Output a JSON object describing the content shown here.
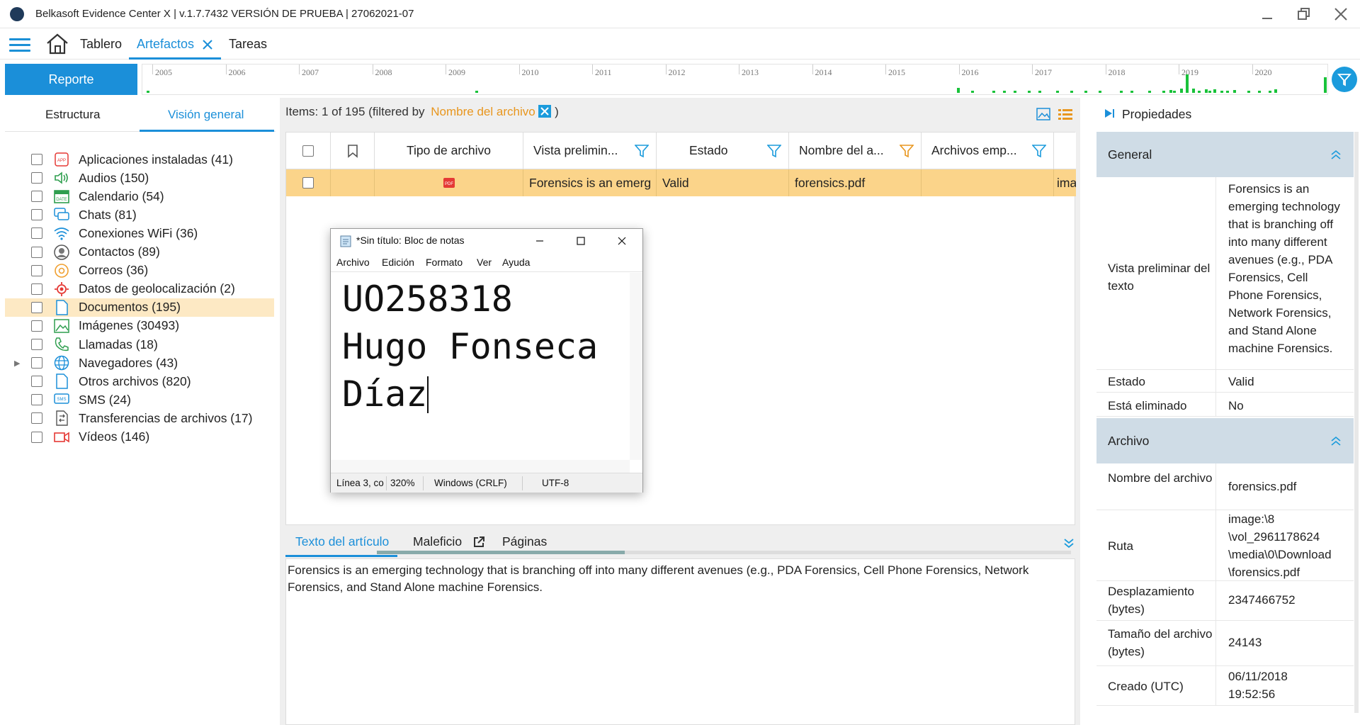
{
  "window": {
    "title": "Belkasoft Evidence Center X | v.1.7.7432 VERSIÓN DE PRUEBA | 27062021-07"
  },
  "nav": {
    "home": "Tablero",
    "tab_active": "Artefactos",
    "tab_tasks": "Tareas"
  },
  "toolbar": {
    "report_label": "Reporte"
  },
  "timeline": {
    "years": [
      "2005",
      "2006",
      "2007",
      "2008",
      "2009",
      "2010",
      "2011",
      "2012",
      "2013",
      "2014",
      "2015",
      "2016",
      "2017",
      "2018",
      "2019",
      "2020"
    ]
  },
  "left": {
    "tabs": [
      "Estructura",
      "Visión general"
    ],
    "items": [
      {
        "label": "Aplicaciones instaladas (41)",
        "icon": "app-icon"
      },
      {
        "label": "Audios (150)",
        "icon": "audio-icon"
      },
      {
        "label": "Calendario (54)",
        "icon": "calendar-icon"
      },
      {
        "label": "Chats (81)",
        "icon": "chat-icon"
      },
      {
        "label": "Conexiones WiFi (36)",
        "icon": "wifi-icon"
      },
      {
        "label": "Contactos (89)",
        "icon": "contact-icon"
      },
      {
        "label": "Correos (36)",
        "icon": "mail-icon"
      },
      {
        "label": "Datos de geolocalización (2)",
        "icon": "location-icon"
      },
      {
        "label": "Documentos (195)",
        "icon": "document-icon"
      },
      {
        "label": "Imágenes (30493)",
        "icon": "image-icon"
      },
      {
        "label": "Llamadas (18)",
        "icon": "phone-icon"
      },
      {
        "label": "Navegadores (43)",
        "icon": "globe-icon"
      },
      {
        "label": "Otros archivos (820)",
        "icon": "file-icon"
      },
      {
        "label": "SMS (24)",
        "icon": "sms-icon"
      },
      {
        "label": "Transferencias de archivos (17)",
        "icon": "transfer-icon"
      },
      {
        "label": "Vídeos (146)",
        "icon": "video-icon"
      }
    ]
  },
  "middle": {
    "items_prefix": "Items: 1 of 195 (filtered by",
    "filter_name": "Nombre del archivo",
    "items_suffix": ")",
    "columns": [
      "Tipo de archivo",
      "Vista prelimin...",
      "Estado",
      "Nombre del a...",
      "Archivos emp..."
    ],
    "row": {
      "preview": "Forensics is an emerg",
      "status": "Valid",
      "filename": "forensics.pdf",
      "extra": "ima"
    },
    "bottom_tabs": [
      "Texto del artículo",
      "Maleficio",
      "Páginas"
    ],
    "article_text": "Forensics is an emerging technology that is branching off into many different avenues (e.g., PDA Forensics, Cell Phone Forensics, Network Forensics, and Stand Alone machine Forensics."
  },
  "notepad": {
    "title": "*Sin título: Bloc de notas",
    "menu": [
      "Archivo",
      "Edición",
      "Formato",
      "Ver",
      "Ayuda"
    ],
    "lines": [
      "UO258318",
      "Hugo Fonseca",
      "Díaz"
    ],
    "status": {
      "pos": "Línea 3, co",
      "zoom": "320%",
      "eol": "Windows (CRLF)",
      "enc": "UTF-8"
    }
  },
  "props": {
    "title": "Propiedades",
    "general_header": "General",
    "preview_key": "Vista preliminar del texto",
    "preview_val": "Forensics is an emerging technology that is branching off into many different avenues (e.g., PDA Forensics, Cell Phone Forensics, Network Forensics, and Stand Alone machine Forensics.",
    "state_key": "Estado",
    "state_val": "Valid",
    "deleted_key": "Está eliminado",
    "deleted_val": "No",
    "file_header": "Archivo",
    "name_key": "Nombre del archivo",
    "name_val": "forensics.pdf",
    "path_key": "Ruta",
    "path_val": "image:\\8 \\vol_2961178624 \\media\\0\\Download \\forensics.pdf",
    "offset_key": "Desplazamiento (bytes)",
    "offset_val": "2347466752",
    "size_key": "Tamaño del archivo (bytes)",
    "size_val": "24143",
    "created_key": "Creado (UTC)",
    "created_val": "06/11/2018 19:52:56"
  },
  "colors": {
    "accent": "#1b8fd9",
    "selected_row": "#fbd48a",
    "filter_orange": "#e8961e",
    "section": "#cfdce6"
  }
}
